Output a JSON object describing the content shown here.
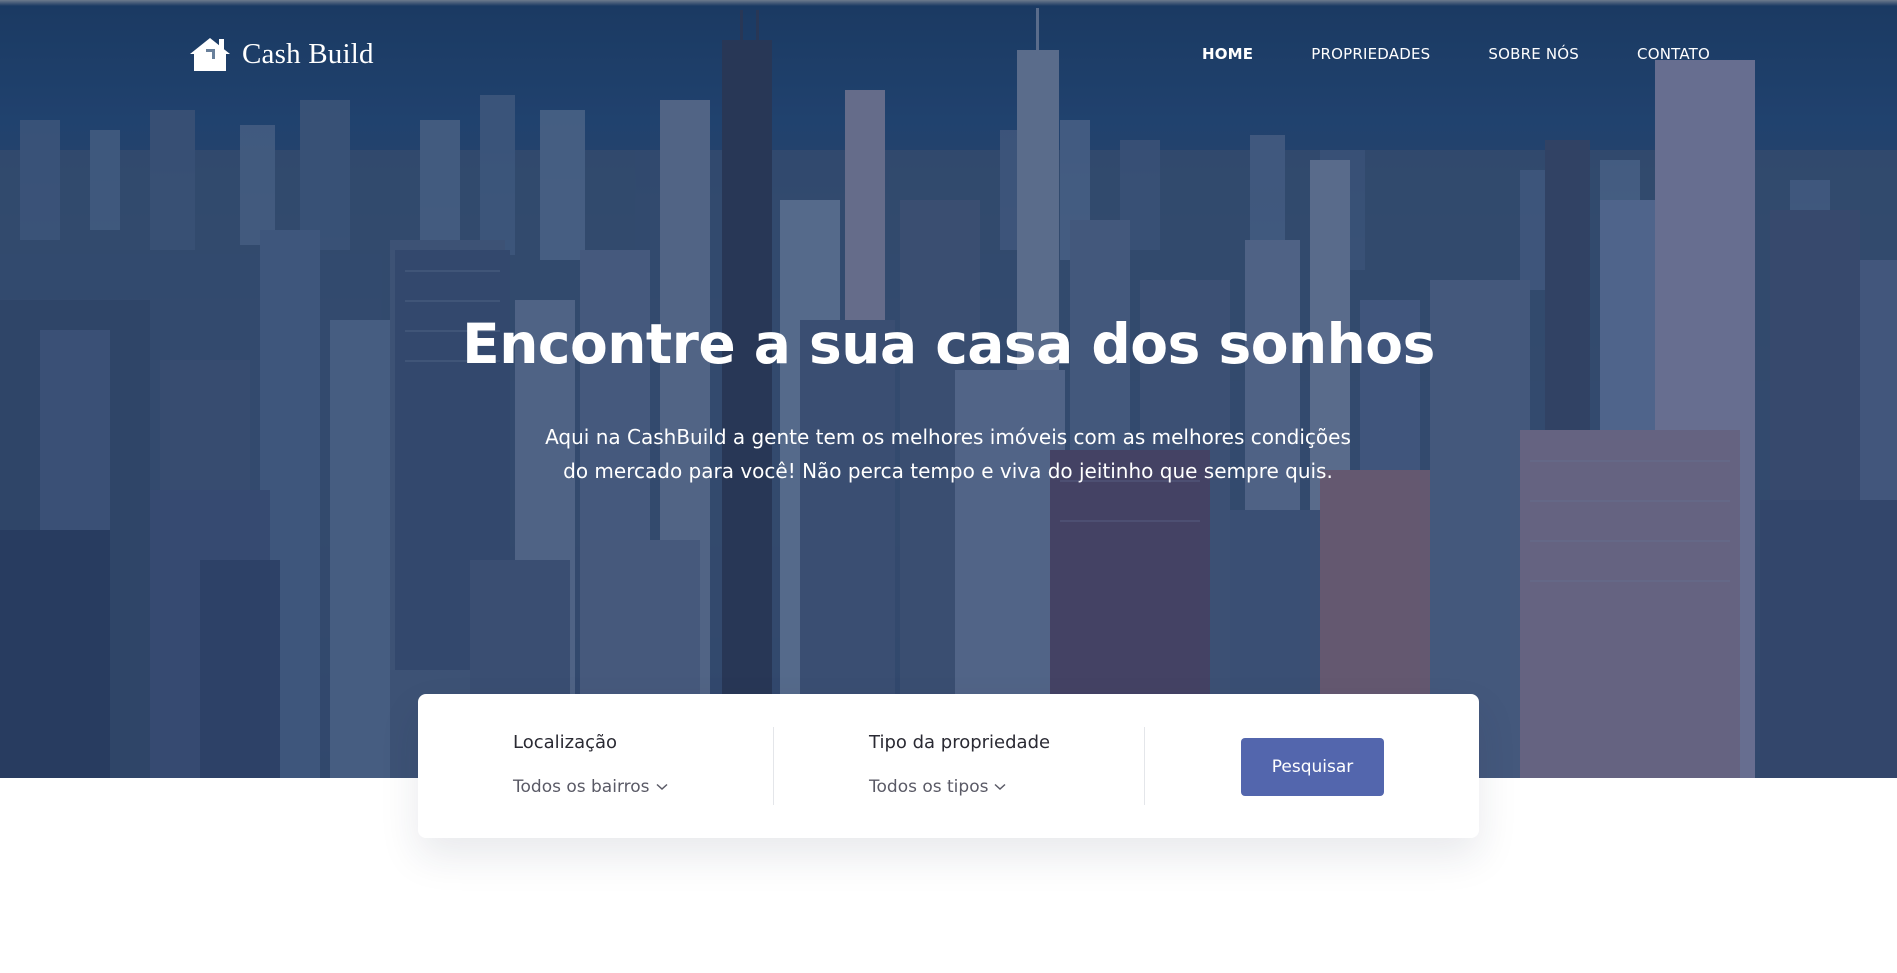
{
  "brand": {
    "name": "Cash Build",
    "icon": "house-icon"
  },
  "nav": {
    "items": [
      {
        "label": "HOME",
        "active": true
      },
      {
        "label": "PROPRIEDADES",
        "active": false
      },
      {
        "label": "SOBRE NÓS",
        "active": false
      },
      {
        "label": "CONTATO",
        "active": false
      }
    ]
  },
  "hero": {
    "title": "Encontre a sua casa dos sonhos",
    "subtitle_line1": "Aqui na CashBuild a gente tem os melhores imóveis com as melhores condições",
    "subtitle_line2": "do mercado para você! Não perca tempo e viva do jeitinho que sempre quis.",
    "background": "city-skyline-photo"
  },
  "search": {
    "location": {
      "label": "Localização",
      "value": "Todos os bairros",
      "icon": "chevron-down-icon"
    },
    "type": {
      "label": "Tipo da propriedade",
      "value": "Todos os tipos",
      "icon": "chevron-down-icon"
    },
    "button_label": "Pesquisar"
  },
  "colors": {
    "accent": "#5366ad",
    "hero_overlay": "#1c3460",
    "text_dark": "#2a2a33"
  }
}
